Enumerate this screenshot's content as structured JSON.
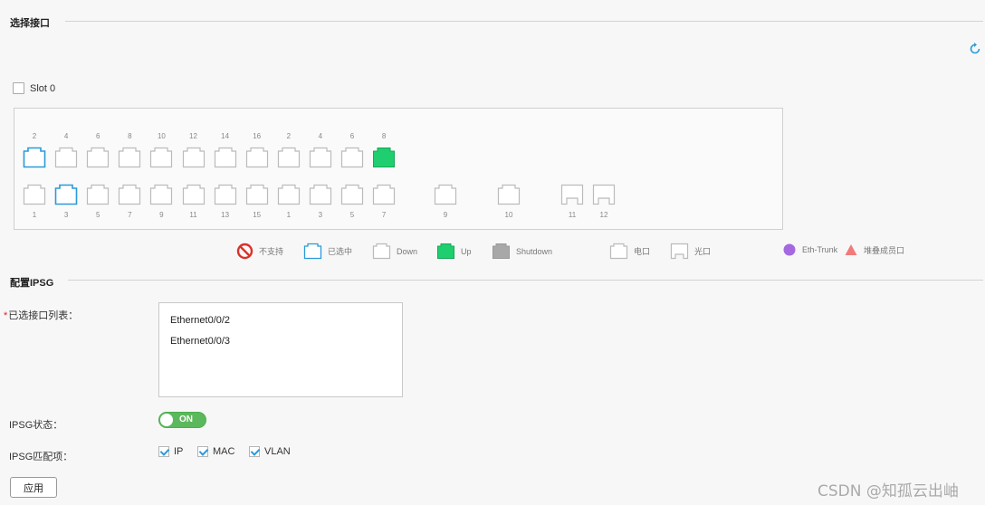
{
  "sections": {
    "select_interface_title": "选择接口",
    "config_ipsg_title": "配置IPSG"
  },
  "slot": {
    "label": "Slot 0",
    "checked": false
  },
  "ports": {
    "top": [
      {
        "num": "2",
        "state": "selected"
      },
      {
        "num": "4",
        "state": "down"
      },
      {
        "num": "6",
        "state": "down"
      },
      {
        "num": "8",
        "state": "down"
      },
      {
        "num": "10",
        "state": "down"
      },
      {
        "num": "12",
        "state": "down"
      },
      {
        "num": "14",
        "state": "down"
      },
      {
        "num": "16",
        "state": "down"
      },
      {
        "num": "2",
        "state": "down"
      },
      {
        "num": "4",
        "state": "down"
      },
      {
        "num": "6",
        "state": "down"
      },
      {
        "num": "8",
        "state": "up"
      }
    ],
    "bottom": [
      {
        "num": "1",
        "state": "down"
      },
      {
        "num": "3",
        "state": "selected"
      },
      {
        "num": "5",
        "state": "down"
      },
      {
        "num": "7",
        "state": "down"
      },
      {
        "num": "9",
        "state": "down"
      },
      {
        "num": "11",
        "state": "down"
      },
      {
        "num": "13",
        "state": "down"
      },
      {
        "num": "15",
        "state": "down"
      },
      {
        "num": "1",
        "state": "down"
      },
      {
        "num": "3",
        "state": "down"
      },
      {
        "num": "5",
        "state": "down"
      },
      {
        "num": "7",
        "state": "down"
      }
    ],
    "extra": [
      {
        "num": "9",
        "type": "electric"
      },
      {
        "num": "10",
        "type": "electric"
      },
      {
        "num": "11",
        "type": "optical"
      },
      {
        "num": "12",
        "type": "optical"
      }
    ]
  },
  "legend": {
    "unsupported": "不支持",
    "selected": "已选中",
    "down": "Down",
    "up": "Up",
    "shutdown": "Shutdown",
    "electric": "电口",
    "optical": "光口",
    "eth_trunk": "Eth-Trunk",
    "stack_member": "堆叠成员口"
  },
  "form": {
    "selected_list_label": "已选接口列表：",
    "selected_interfaces": [
      "Ethernet0/0/2",
      "Ethernet0/0/3"
    ],
    "ipsg_status_label": "IPSG状态：",
    "ipsg_status_value": "ON",
    "ipsg_match_label": "IPSG匹配项：",
    "match_items": [
      {
        "label": "IP",
        "checked": true
      },
      {
        "label": "MAC",
        "checked": true
      },
      {
        "label": "VLAN",
        "checked": true
      }
    ],
    "apply_label": "应用"
  },
  "watermark": "CSDN @知孤云出岫",
  "colors": {
    "selected_border": "#2a9ad8",
    "up_fill": "#1fcf6f",
    "shutdown_fill": "#a8a8a8",
    "unsupported": "#d9322b",
    "eth_trunk": "#a468e0",
    "stack_member": "#f27a7a"
  }
}
